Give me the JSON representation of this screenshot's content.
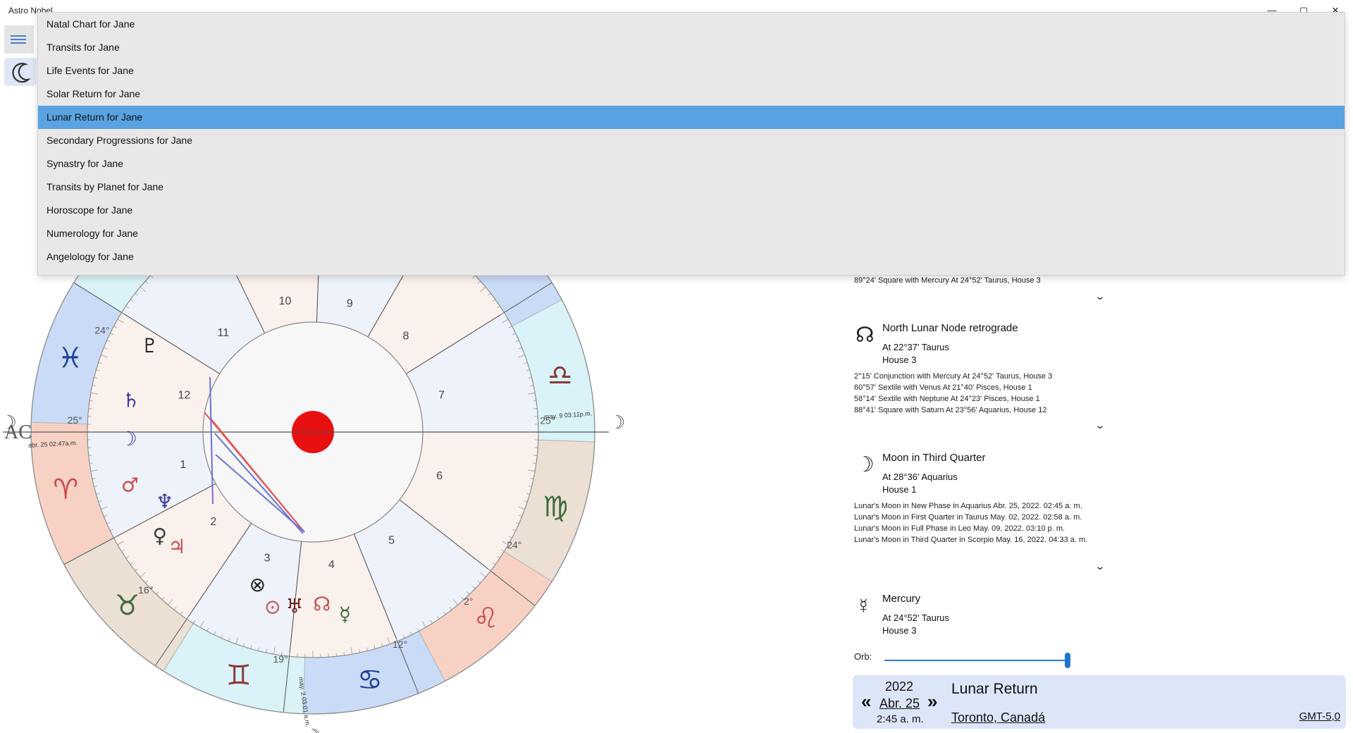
{
  "app": {
    "title": "Astro Nobel"
  },
  "window": {
    "minimize_glyph": "—",
    "maximize_glyph": "▢",
    "close_glyph": "✕"
  },
  "menu": {
    "items": [
      "Natal Chart for Jane",
      "Transits for Jane",
      "Life Events for Jane",
      "Solar Return for Jane",
      "Lunar Return for Jane",
      "Secondary Progressions for Jane",
      "Synastry for Jane",
      "Transits by Planet for Jane",
      "Horoscope for Jane",
      "Numerology for Jane",
      "Angelology for Jane"
    ],
    "selected_index": 4
  },
  "chart": {
    "cusp_labels": {
      "asc": "AC",
      "asc_deg": "25°",
      "dsc_deg": "25°",
      "deg_24_top": "24°",
      "deg_24_right": "24°",
      "deg_16": "16°",
      "deg_19": "19°",
      "deg_12": "12°",
      "deg_2": "2°"
    },
    "houses": [
      "1",
      "2",
      "3",
      "4",
      "5",
      "6",
      "7",
      "8",
      "9",
      "10",
      "11",
      "12"
    ],
    "moon_date_left": "abr. 25 02:47a.m.",
    "moon_date_right": "may. 9 03:11p.m.",
    "moon_date_bottom": "may. 2 03:01 a.m."
  },
  "right_panel": {
    "top_aspect": "89°24' Square with Mercury At 24°52' Taurus, House 3",
    "north_node": {
      "glyph": "☊",
      "title": "North Lunar Node retrograde",
      "position": "At 22°37' Taurus",
      "house": "House 3",
      "aspects": [
        "2°15' Conjunction with Mercury At 24°52' Taurus, House 3",
        "60°57' Sextile with Venus At 21°40' Pisces, House 1",
        "58°14' Sextile with Neptune At 24°23' Pisces, House 1",
        "88°41' Square with Saturn At 23°56' Aquarius, House 12"
      ]
    },
    "moon": {
      "glyph": "☽",
      "title": "Moon in Third Quarter",
      "position": "At 28°36' Aquarius",
      "house": "House 1",
      "aspects": [
        "Lunar's Moon in New Phase in Aquarius Abr. 25, 2022. 02:45 a. m.",
        "Lunar's Moon in First Quarter in Taurus May. 02, 2022. 02:58 a. m.",
        "Lunar's Moon in Full Phase in Leo May. 09, 2022. 03:10 p. m.",
        "Lunar's Moon in Third Quarter in Scorpio May. 16, 2022. 04:33 a. m."
      ]
    },
    "mercury": {
      "glyph": "☿",
      "title": "Mercury",
      "position": "At 24°52' Taurus",
      "house": "House 3"
    },
    "chevron": "⌄",
    "orb_label": "Orb:",
    "orb_value": 1.0
  },
  "footer": {
    "prev": "«",
    "next": "»",
    "year": "2022",
    "date": "Abr. 25",
    "time": "2:45 a. m.",
    "title": "Lunar Return",
    "place": "Toronto, Canadá",
    "tz": "GMT-5,0"
  },
  "colors": {
    "accent": "#5aa3e2",
    "sun": "#e81010",
    "fire": "#f7d2c4",
    "earth": "#ecdfd3",
    "air": "#d9f3f8",
    "water": "#c9dbf6"
  }
}
